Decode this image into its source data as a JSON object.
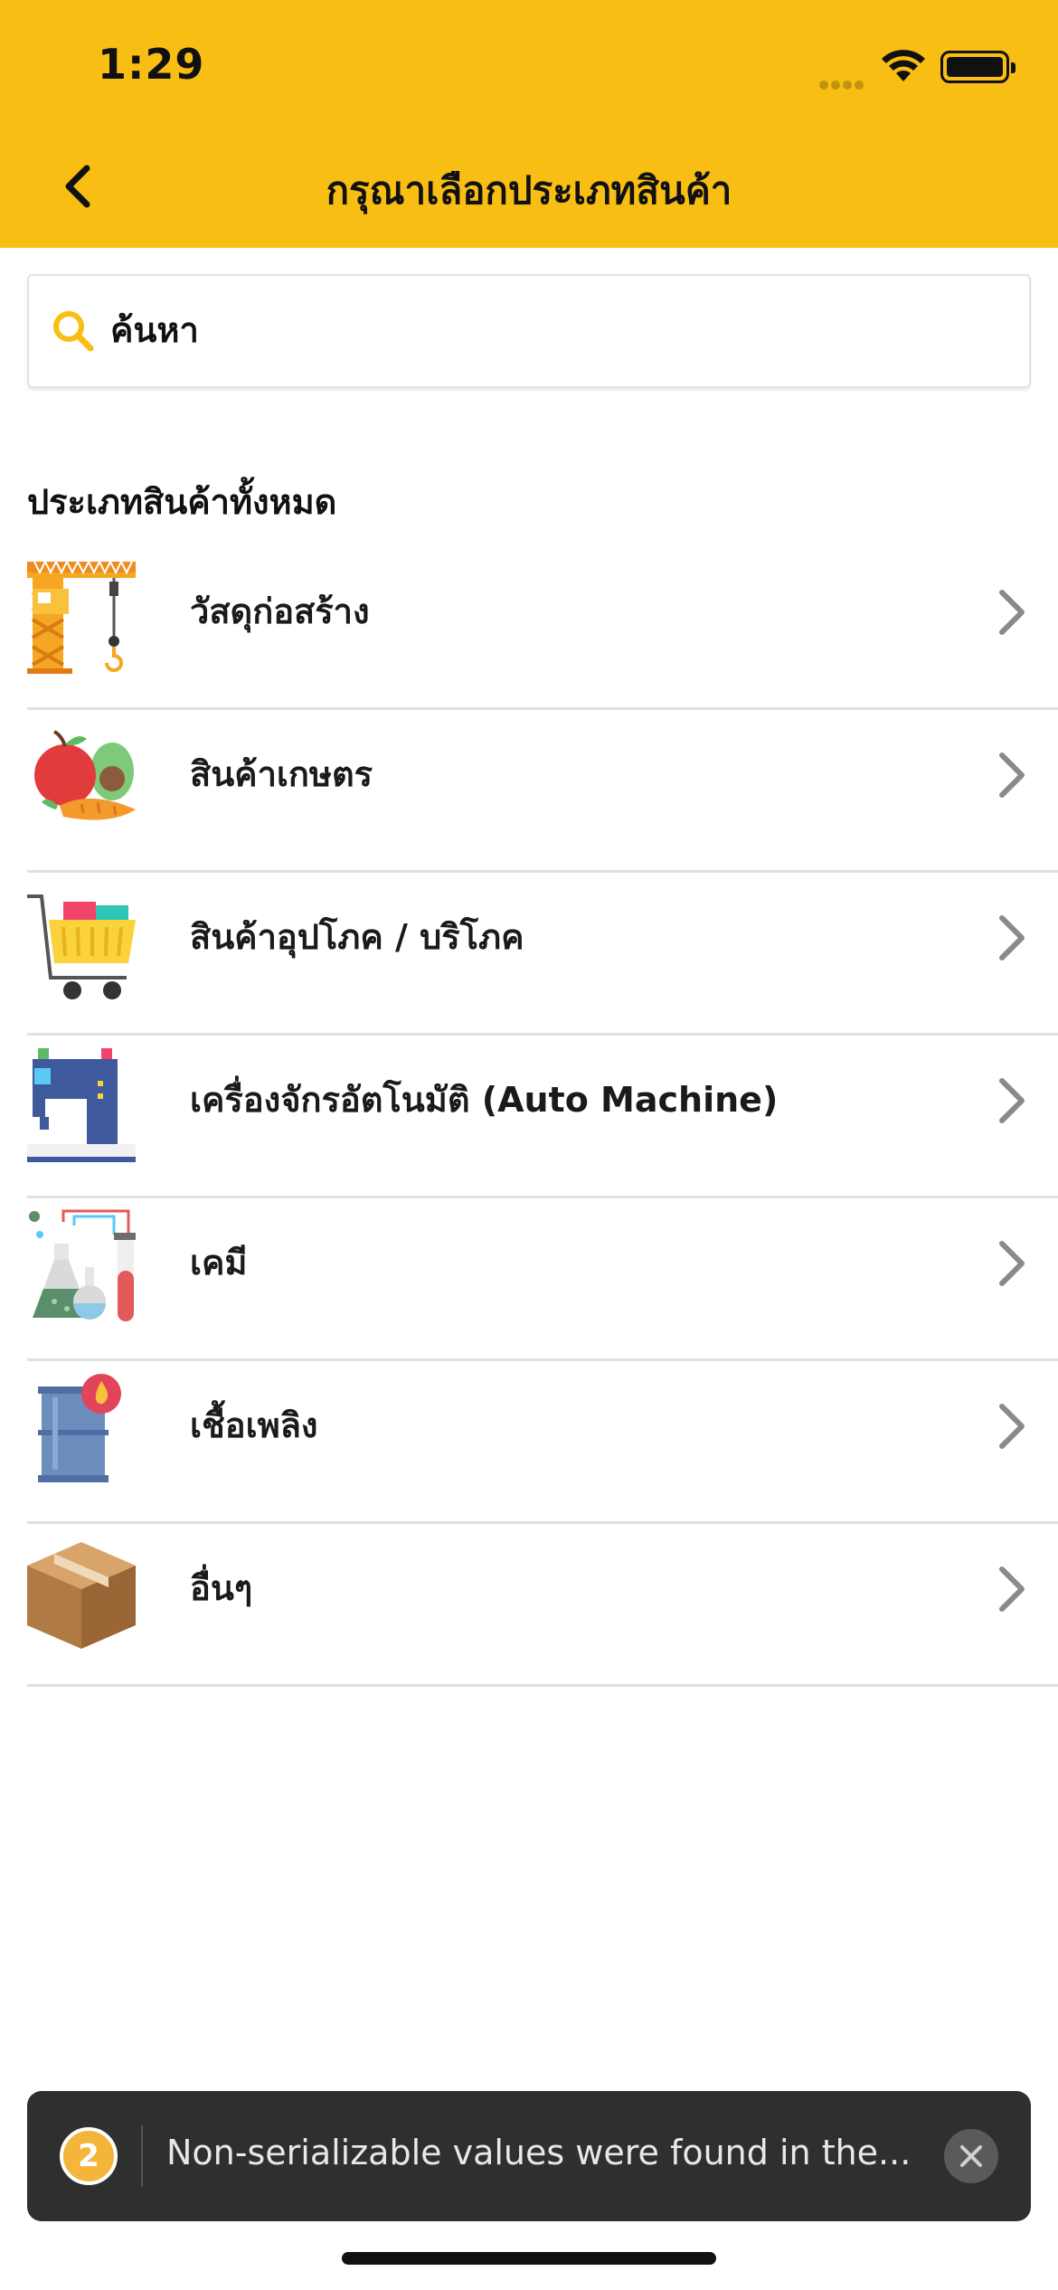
{
  "status_bar": {
    "time": "1:29"
  },
  "header": {
    "title": "กรุณาเลือกประเภทสินค้า"
  },
  "search": {
    "placeholder": "ค้นหา"
  },
  "section": {
    "title": "ประเภทสินค้าทั้งหมด"
  },
  "categories": [
    {
      "label": "วัสดุก่อสร้าง",
      "icon": "construction-crane-icon"
    },
    {
      "label": "สินค้าเกษตร",
      "icon": "agriculture-produce-icon"
    },
    {
      "label": "สินค้าอุปโภค / บริโภค",
      "icon": "shopping-cart-icon"
    },
    {
      "label": "เครื่องจักรอัตโนมัติ (Auto Machine)",
      "icon": "sewing-machine-icon"
    },
    {
      "label": "เคมี",
      "icon": "chemistry-lab-icon"
    },
    {
      "label": "เชื้อเพลิง",
      "icon": "fuel-barrel-icon"
    },
    {
      "label": "อื่นๆ",
      "icon": "cardboard-box-icon"
    }
  ],
  "toast": {
    "count": "2",
    "message": "Non-serializable values were found in the..."
  },
  "colors": {
    "accent": "#F9BE14",
    "toast_bg": "#2f2f2f",
    "badge": "#F4B63A"
  }
}
